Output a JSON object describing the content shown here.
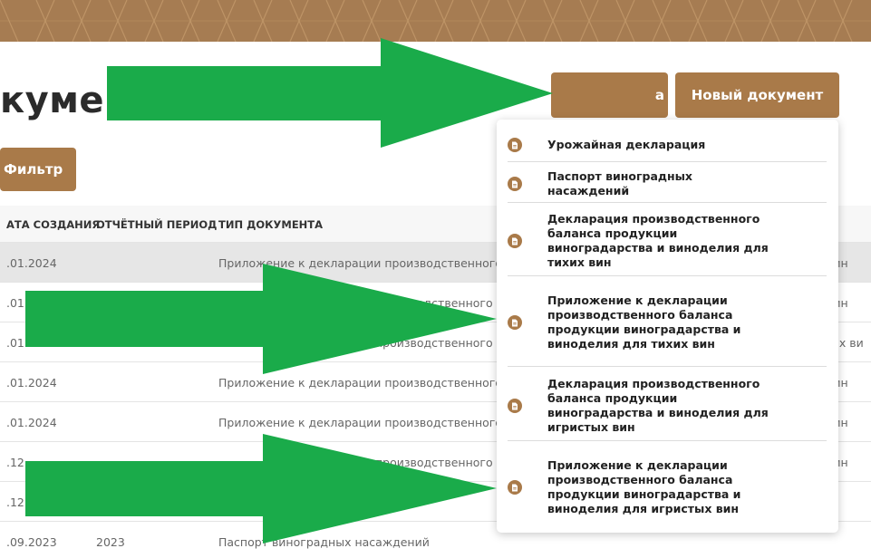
{
  "header": {
    "page_title": "кумен"
  },
  "toolbar": {
    "filter_label": "Фильтр",
    "other_button_label": "а",
    "new_document_label": "Новый документ"
  },
  "table": {
    "columns": [
      "АТА СОЗДАНИЯ",
      "ОТЧЁТНЫЙ ПЕРИОД",
      "ТИП ДОКУМЕНТА"
    ],
    "rows": [
      {
        "date": ".01.2024",
        "period": "",
        "type": "Приложение к декларации производственного б",
        "tail": "вин"
      },
      {
        "date": ".01",
        "period": "",
        "type": "производственного б",
        "tail": "вин"
      },
      {
        "date": ".01",
        "period": "",
        "type": "производственного б",
        "tail": "ых ви"
      },
      {
        "date": ".01.2024",
        "period": "",
        "type": "Приложение к декларации производственного б",
        "tail": "вин"
      },
      {
        "date": ".01.2024",
        "period": "",
        "type": "Приложение к декларации производственного б",
        "tail": "вин"
      },
      {
        "date": ".12",
        "period": "",
        "type": "производственного б",
        "tail": "вин"
      },
      {
        "date": ".12",
        "period": "",
        "type": "",
        "tail": ""
      },
      {
        "date": ".09.2023",
        "period": "2023",
        "type": "Паспорт виноградных насаждений",
        "tail": ""
      }
    ]
  },
  "menu": {
    "items": [
      {
        "label": "Урожайная декларация"
      },
      {
        "label": "Паспорт виноградных насаждений"
      },
      {
        "label": "Декларация производственного баланса продукции виноградарства и виноделия для тихих вин"
      },
      {
        "label": "Приложение к декларации производственного баланса продукции виноградарства и виноделия для тихих вин"
      },
      {
        "label": "Декларация производственного баланса продукции виноградарства и виноделия для игристых вин"
      },
      {
        "label": "Приложение к декларации производственного баланса продукции виноградарства и виноделия для игристых вин"
      }
    ]
  },
  "colors": {
    "accent": "#a97a49",
    "banner": "#a67c52",
    "arrow": "#1aab4a"
  },
  "icons": {
    "menu_item_icon": "document-icon"
  }
}
